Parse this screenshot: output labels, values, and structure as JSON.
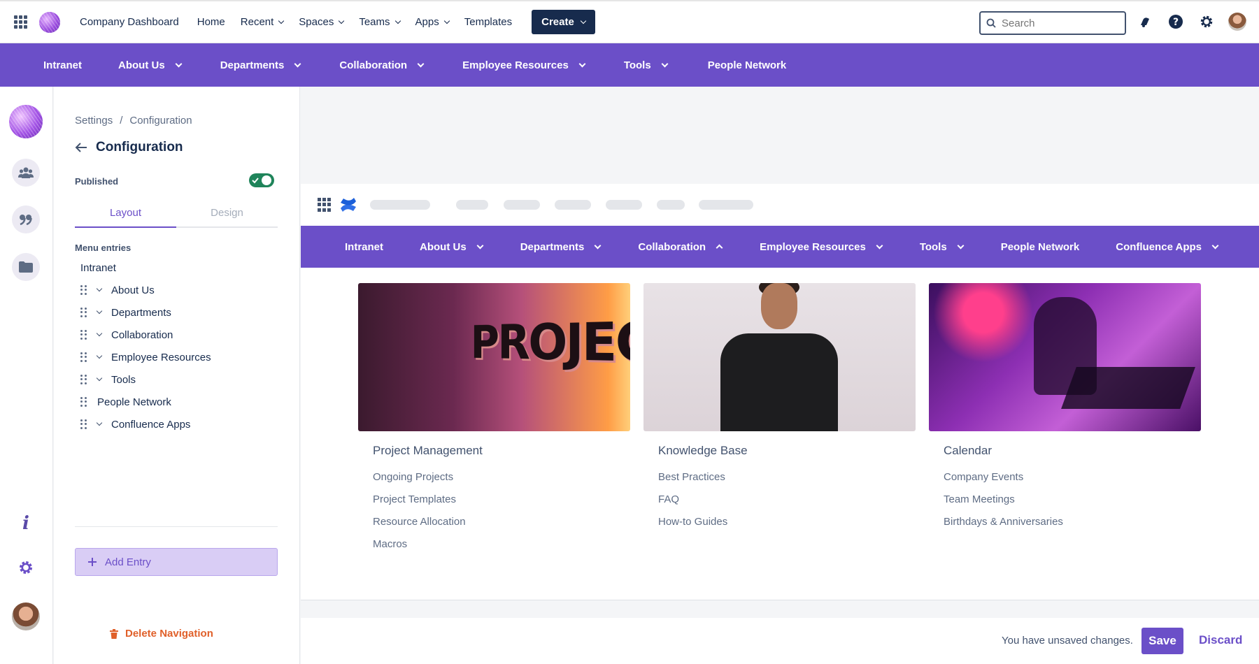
{
  "topbar": {
    "app_title": "Company Dashboard",
    "nav": [
      {
        "label": "Home",
        "has_chevron": false
      },
      {
        "label": "Recent",
        "has_chevron": true
      },
      {
        "label": "Spaces",
        "has_chevron": true
      },
      {
        "label": "Teams",
        "has_chevron": true
      },
      {
        "label": "Apps",
        "has_chevron": true
      },
      {
        "label": "Templates",
        "has_chevron": false
      }
    ],
    "create_label": "Create",
    "search_placeholder": "Search",
    "icons": [
      "notification-bell-icon",
      "help-icon",
      "settings-gear-icon",
      "user-avatar"
    ]
  },
  "main_nav": {
    "items": [
      "Intranet",
      "About Us",
      "Departments",
      "Collaboration",
      "Employee Resources",
      "Tools",
      "People Network"
    ]
  },
  "rail": {
    "icons": [
      "people-icon",
      "quote-icon",
      "folder-icon",
      "info-icon",
      "gear-icon"
    ]
  },
  "panel": {
    "breadcrumb": {
      "root": "Settings",
      "separator": "/",
      "current": "Configuration"
    },
    "title": "Configuration",
    "published_label": "Published",
    "published": true,
    "tabs": [
      "Layout",
      "Design"
    ],
    "active_tab": "Layout",
    "menu_entries_label": "Menu entries",
    "menu_entries": [
      "Intranet",
      "About Us",
      "Departments",
      "Collaboration",
      "Employee Resources",
      "Tools",
      "People Network",
      "Confluence Apps"
    ],
    "add_entry_label": "Add Entry",
    "delete_label": "Delete Navigation"
  },
  "preview": {
    "nav_items": [
      "Intranet",
      "About Us",
      "Departments",
      "Collaboration",
      "Employee Resources",
      "Tools",
      "People Network",
      "Confluence Apps"
    ],
    "expanded_item": "Collaboration",
    "cards": [
      {
        "image_text": "PROJECTS",
        "title": "Project Management",
        "links": [
          "Ongoing Projects",
          "Project Templates",
          "Resource Allocation",
          "Macros"
        ]
      },
      {
        "title": "Knowledge Base",
        "links": [
          "Best Practices",
          "FAQ",
          "How-to Guides"
        ]
      },
      {
        "title": "Calendar",
        "links": [
          "Company Events",
          "Team Meetings",
          "Birthdays & Anniversaries"
        ]
      }
    ]
  },
  "footer": {
    "unsaved_text": "You have unsaved changes.",
    "save_label": "Save",
    "discard_label": "Discard"
  },
  "colors": {
    "brand_purple": "#6b4fc8",
    "toggle_green": "#1f845a",
    "danger_orange": "#e0602a",
    "dark_navy": "#172b4d"
  }
}
